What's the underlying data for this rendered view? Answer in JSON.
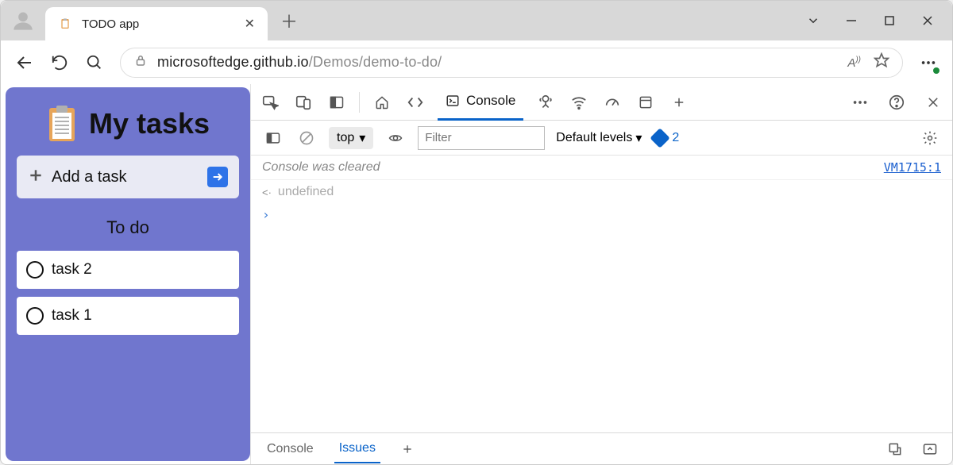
{
  "browser": {
    "tab_title": "TODO app",
    "url_host": "microsoftedge.github.io",
    "url_path": "/Demos/demo-to-do/"
  },
  "app": {
    "title": "My tasks",
    "add_task_label": "Add a task",
    "section_todo": "To do",
    "tasks": [
      "task 2",
      "task 1"
    ]
  },
  "devtools": {
    "active_tab": "Console",
    "context": "top",
    "filter_placeholder": "Filter",
    "levels_label": "Default levels",
    "issues_count": "2",
    "cleared_msg": "Console was cleared",
    "cleared_source": "VM1715:1",
    "undefined_text": "undefined",
    "footer_console": "Console",
    "footer_issues": "Issues"
  }
}
